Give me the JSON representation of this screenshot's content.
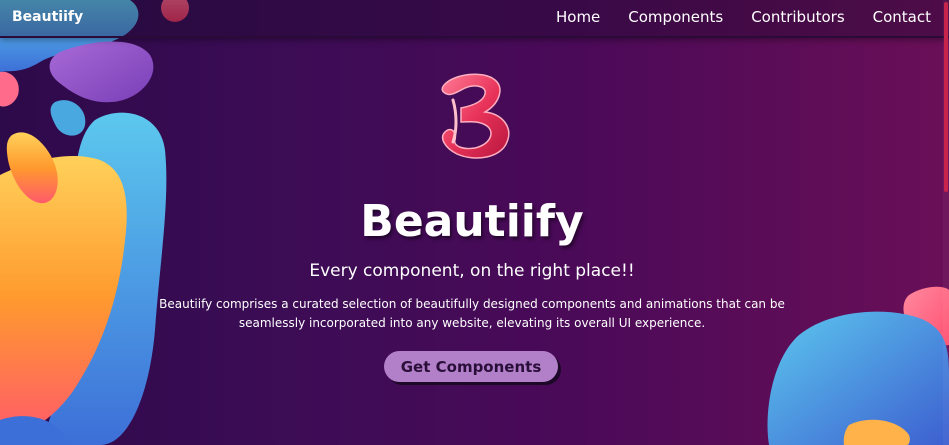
{
  "navbar": {
    "brand": "Beautiify",
    "links": [
      "Home",
      "Components",
      "Contributors",
      "Contact"
    ]
  },
  "hero": {
    "logo_letter": "B",
    "title": "Beautiify",
    "tagline": "Every component, on the right place!!",
    "description": "Beautiify comprises a curated selection of beautifully designed components and animations that can be seamlessly incorporated into any website, elevating its overall UI experience.",
    "cta_label": "Get Components"
  },
  "colors": {
    "background_left": "#2d0a4a",
    "background_right": "#6a0f58",
    "logo_pink": "#e8335a",
    "cta_background": "#b27fc9",
    "cta_text": "#2a0f3a",
    "scrollbar": "#c8234a"
  },
  "icons": {
    "logo": "b-logo-icon"
  }
}
